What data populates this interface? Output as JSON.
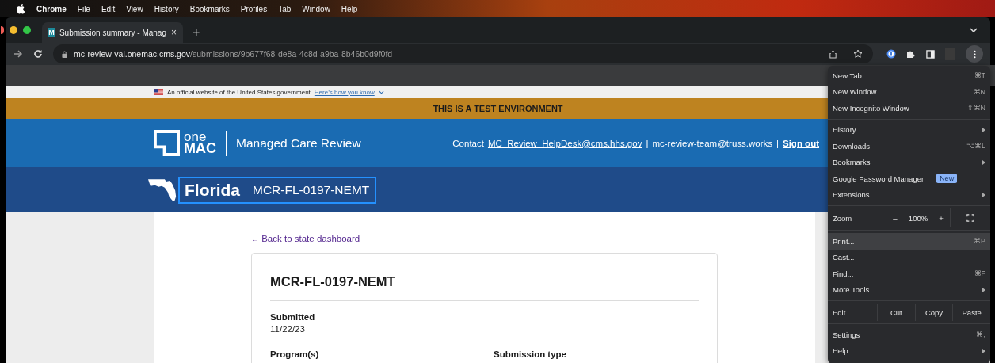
{
  "menubar": {
    "items": [
      "Chrome",
      "File",
      "Edit",
      "View",
      "History",
      "Bookmarks",
      "Profiles",
      "Tab",
      "Window",
      "Help"
    ]
  },
  "tabs": [
    {
      "favicon": "M",
      "title": "Submission summary - Manag",
      "close": "×",
      "selected": true
    }
  ],
  "new_tab": "+",
  "address": {
    "host": "mc-review-val.onemac.cms.gov",
    "path": "/submissions/9b677f68-de8a-4c8d-a9ba-8b46b0d9f0fd"
  },
  "banner": {
    "text": "An official website of the United States government",
    "link": "Here’s how you know"
  },
  "test_bar": "THIS IS A TEST ENVIRONMENT",
  "header": {
    "logo_top": "one",
    "logo_bottom": "MAC",
    "app_name": "Managed Care Review",
    "contact_label": "Contact",
    "help_email": "MC_Review_HelpDesk@cms.hhs.gov",
    "team_email": "mc-review-team@truss.works",
    "separator": "|",
    "sign_out": "Sign out"
  },
  "state_bar": {
    "state": "Florida",
    "submission_id": "MCR-FL-0197-NEMT"
  },
  "back_link": {
    "arrow": "←",
    "label": "Back to state dashboard"
  },
  "summary": {
    "title": "MCR-FL-0197-NEMT",
    "submitted_label": "Submitted",
    "submitted_value": "11/22/23",
    "columns": [
      "Program(s)",
      "Submission type"
    ]
  },
  "menu": {
    "sections": [
      [
        {
          "kind": "item",
          "label": "New Tab",
          "shortcut": "⌘T",
          "highlighted": false
        },
        {
          "kind": "item",
          "label": "New Window",
          "shortcut": "⌘N",
          "highlighted": false
        },
        {
          "kind": "item",
          "label": "New Incognito Window",
          "shortcut": "⇧⌘N",
          "highlighted": false
        }
      ],
      [
        {
          "kind": "submenu",
          "label": "History",
          "highlighted": false
        },
        {
          "kind": "item",
          "label": "Downloads",
          "shortcut": "⌥⌘L",
          "highlighted": false
        },
        {
          "kind": "submenu",
          "label": "Bookmarks",
          "highlighted": false
        },
        {
          "kind": "badge",
          "label": "Google Password Manager",
          "badge": "New",
          "highlighted": false
        },
        {
          "kind": "submenu",
          "label": "Extensions",
          "highlighted": false
        }
      ],
      [
        {
          "kind": "zoom",
          "label": "Zoom",
          "minus": "–",
          "value": "100%",
          "plus": "+"
        }
      ],
      [
        {
          "kind": "item",
          "label": "Print...",
          "shortcut": "⌘P",
          "highlighted": true
        },
        {
          "kind": "item",
          "label": "Cast...",
          "highlighted": false
        },
        {
          "kind": "item",
          "label": "Find...",
          "shortcut": "⌘F",
          "highlighted": false
        },
        {
          "kind": "submenu",
          "label": "More Tools",
          "highlighted": false
        }
      ],
      [
        {
          "kind": "edit",
          "label": "Edit",
          "buttons": [
            "Cut",
            "Copy",
            "Paste"
          ]
        }
      ],
      [
        {
          "kind": "item",
          "label": "Settings",
          "shortcut": "⌘,",
          "highlighted": false
        },
        {
          "kind": "submenu",
          "label": "Help",
          "highlighted": false
        }
      ]
    ]
  }
}
